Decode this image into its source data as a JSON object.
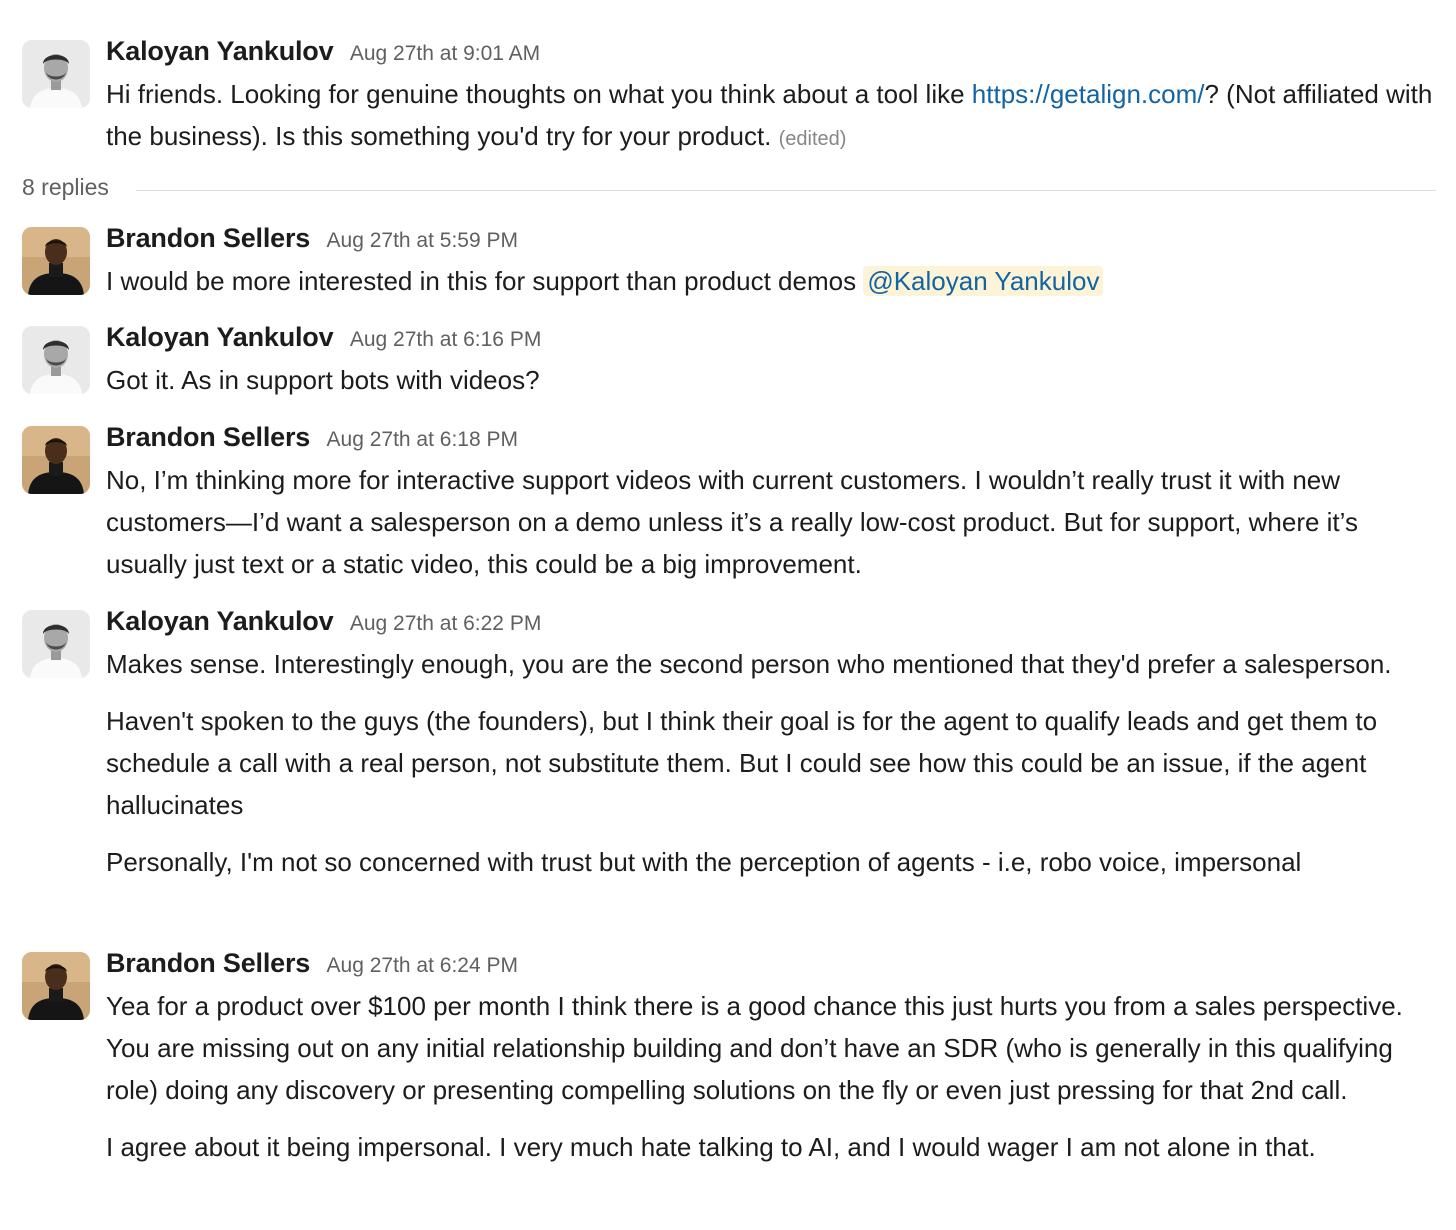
{
  "thread": {
    "replies_label": "8 replies"
  },
  "messages": [
    {
      "author": "Kaloyan Yankulov",
      "time": "Aug 27th at 9:01 AM",
      "paragraphs": [],
      "intro_text": "Hi friends. Looking for genuine thoughts on what you think about a tool like ",
      "link": "https://getalign.com/",
      "tail_text": "? (Not affiliated with the business). Is this something you'd try for your product. ",
      "edited": "(edited)"
    },
    {
      "author": "Brandon Sellers",
      "time": "Aug 27th at 5:59 PM",
      "text": "I would be more interested in this for support than product demos ",
      "mention": "@Kaloyan Yankulov"
    },
    {
      "author": "Kaloyan Yankulov",
      "time": "Aug 27th at 6:16 PM",
      "text": "Got it. As in support bots with videos?"
    },
    {
      "author": "Brandon Sellers",
      "time": "Aug 27th at 6:18 PM",
      "text": "No, I’m thinking more for interactive support videos with current customers. I wouldn’t really trust it with new customers—I’d want a salesperson on a demo unless it’s a really low-cost product. But for support, where it’s usually just text or a static video, this could be a big improvement."
    },
    {
      "author": "Kaloyan Yankulov",
      "time": "Aug 27th at 6:22 PM",
      "paragraphs": [
        "Makes sense. Interestingly enough, you are the second person who mentioned that they'd prefer a salesperson.",
        "Haven't spoken to the guys (the founders), but I think their goal is for the agent to qualify leads and get them to schedule a call with a real person, not substitute them. But I could see how this could be an issue, if the agent hallucinates",
        "Personally, I'm not so concerned with trust but with the perception of agents - i.e, robo voice, impersonal"
      ]
    },
    {
      "author": "Brandon Sellers",
      "time": "Aug 27th at 6:24 PM",
      "paragraphs": [
        "Yea for a product over $100 per month I think there is a good chance this just hurts you from a sales perspective. You are missing out on any initial relationship building and don’t have an SDR (who is generally in this qualifying role) doing any discovery or presenting compelling solutions on the fly or even just pressing for that 2nd call.",
        "I agree about it being impersonal. I very much hate talking to AI, and I would wager I am not alone in that."
      ]
    }
  ]
}
